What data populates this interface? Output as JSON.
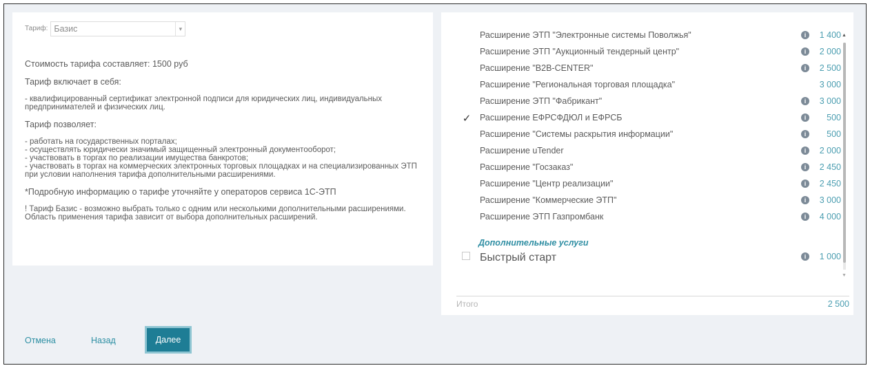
{
  "tariff": {
    "label": "Тариф:",
    "value": "Базис",
    "arrow": "▾"
  },
  "description": {
    "cost": "Стоимость тарифа составляет: 1500 руб",
    "includes_title": "Тариф включает в себя:",
    "includes_text": "- квалифицированный сертификат электронной подписи для юридических лиц, индивидуальных предпринимателей и физических лиц.",
    "allows_title": "Тариф позволяет:",
    "allows_items": [
      "- работать на государственных порталах;",
      "- осуществлять юридически значимый защищенный электронный документооборот;",
      "- участвовать в торгах по реализации имущества банкротов;",
      "- участвовать в торгах на коммерческих электронных торговых площадках и на специализированных ЭТП при условии наполнения тарифа дополнительными расширениями."
    ],
    "note": "*Подробную информацию о тарифе уточняйте у операторов сервиса 1С-ЭТП",
    "warning_1": "! Тариф Базис - возможно выбрать только с одним или несколькими дополнительными расширениями.",
    "warning_2": "Область применения тарифа зависит от выбора дополнительных расширений."
  },
  "extensions": [
    {
      "name": "Расширение ЭТП \"Электронные системы Поволжья\"",
      "price": "1 400",
      "checked": false,
      "info": true
    },
    {
      "name": "Расширение ЭТП \"Аукционный тендерный центр\"",
      "price": "2 000",
      "checked": false,
      "info": true
    },
    {
      "name": "Расширение \"B2B-CENTER\"",
      "price": "2 500",
      "checked": false,
      "info": true
    },
    {
      "name": "Расширение \"Региональная торговая площадка\"",
      "price": "3 000",
      "checked": false,
      "info": false
    },
    {
      "name": "Расширение ЭТП \"Фабрикант\"",
      "price": "3 000",
      "checked": false,
      "info": true
    },
    {
      "name": "Расширение ЕФРСФДЮЛ и ЕФРСБ",
      "price": "500",
      "checked": true,
      "info": true
    },
    {
      "name": "Расширение \"Системы раскрытия информации\"",
      "price": "500",
      "checked": false,
      "info": true
    },
    {
      "name": "Расширение uTender",
      "price": "2 000",
      "checked": false,
      "info": true
    },
    {
      "name": "Расширение \"Госзаказ\"",
      "price": "2 450",
      "checked": false,
      "info": true
    },
    {
      "name": "Расширение \"Центр реализации\"",
      "price": "2 450",
      "checked": false,
      "info": true
    },
    {
      "name": "Расширение \"Коммерческие ЭТП\"",
      "price": "3 000",
      "checked": false,
      "info": true
    },
    {
      "name": "Расширение ЭТП Газпромбанк",
      "price": "4 000",
      "checked": false,
      "info": true
    }
  ],
  "additional_services": {
    "title": "Дополнительные услуги",
    "items": [
      {
        "name": "Быстрый старт",
        "price": "1 000",
        "checked": false
      }
    ]
  },
  "total": {
    "label": "Итого",
    "value": "2 500"
  },
  "buttons": {
    "cancel": "Отмена",
    "back": "Назад",
    "next": "Далее"
  },
  "icons": {
    "info": "i",
    "check": "✓",
    "scroll_up": "▲",
    "scroll_down": "▼"
  },
  "colors": {
    "accent": "#2d8fa3",
    "primary_button": "#1e7d95",
    "price": "#4a9db0"
  }
}
